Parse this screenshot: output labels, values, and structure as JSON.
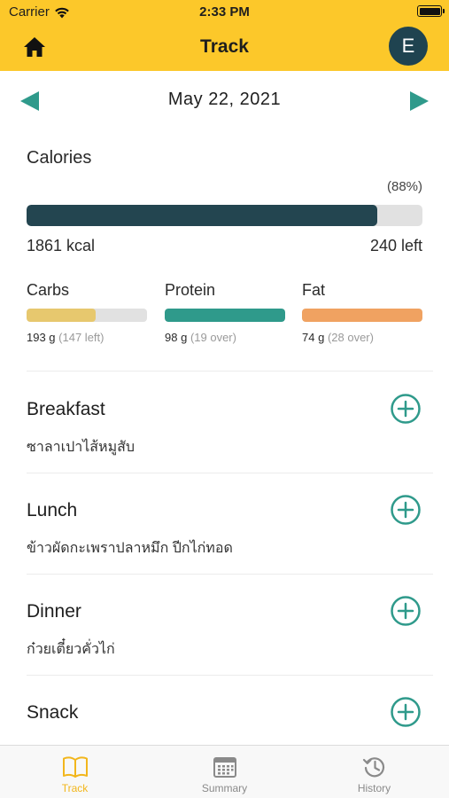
{
  "status_bar": {
    "carrier": "Carrier",
    "time": "2:33 PM"
  },
  "nav": {
    "title": "Track",
    "avatar_initial": "E"
  },
  "date": {
    "label": "May  22, 2021"
  },
  "calories": {
    "label": "Calories",
    "percent_label": "(88%)",
    "fraction": 0.885,
    "consumed_label": "1861 kcal",
    "remaining_label": "240 left"
  },
  "macros": [
    {
      "name": "Carbs",
      "amount": "193 g",
      "note": "(147 left)",
      "fraction": 0.57,
      "color": "#e7c86e"
    },
    {
      "name": "Protein",
      "amount": "98 g",
      "note": "(19 over)",
      "fraction": 1.0,
      "color": "#2f9a8b"
    },
    {
      "name": "Fat",
      "amount": "74 g",
      "note": "(28 over)",
      "fraction": 1.0,
      "color": "#f0a261"
    }
  ],
  "meals": [
    {
      "title": "Breakfast",
      "items": "ซาลาเปาไส้หมูสับ"
    },
    {
      "title": "Lunch",
      "items": "ข้าวผัดกะเพราปลาหมึก  ปีกไก่ทอด"
    },
    {
      "title": "Dinner",
      "items": "ก๋วยเตี๋ยวคั่วไก่"
    },
    {
      "title": "Snack",
      "items": ""
    }
  ],
  "tabs": [
    {
      "label": "Track",
      "icon": "book-open-icon",
      "active": true
    },
    {
      "label": "Summary",
      "icon": "calendar-icon",
      "active": false
    },
    {
      "label": "History",
      "icon": "history-icon",
      "active": false
    }
  ],
  "colors": {
    "header": "#fcc82a",
    "accent_teal": "#2f9a8b",
    "calorie_bar": "#234550",
    "avatar": "#1f4350",
    "active_tab": "#f2b61c"
  }
}
